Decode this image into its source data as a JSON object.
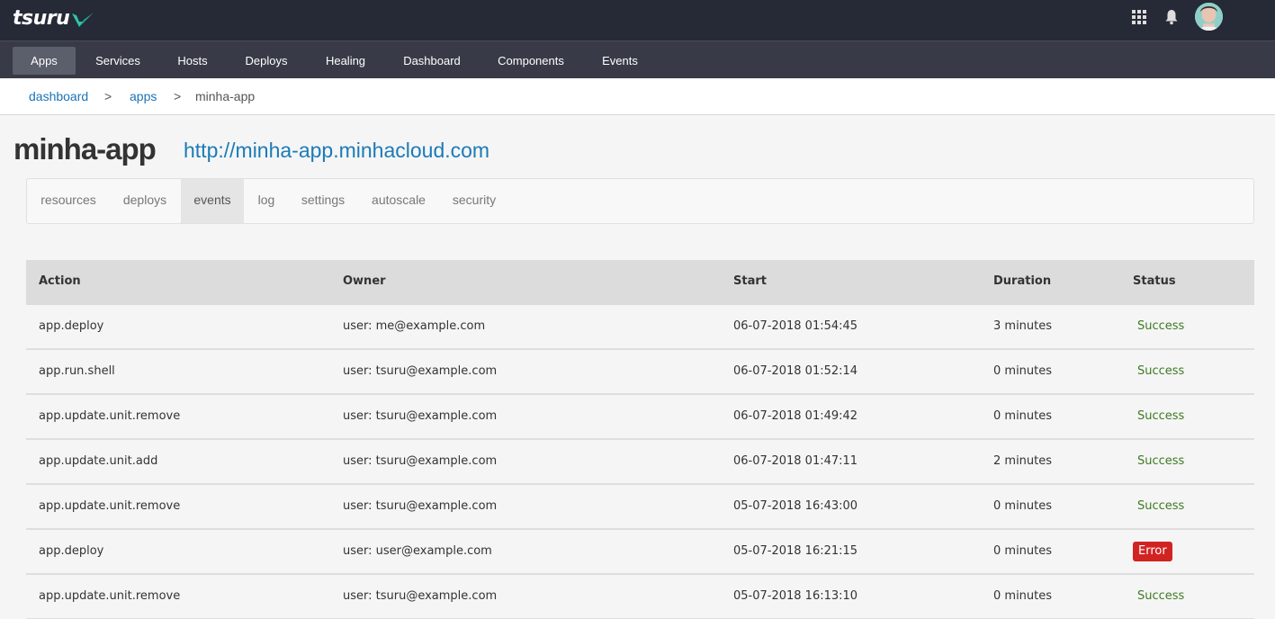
{
  "brand": {
    "name": "tsuru",
    "logo_mark_color": "#2ec4a4"
  },
  "topbar": {
    "icons": [
      "apps-grid-icon",
      "bell-icon",
      "avatar"
    ]
  },
  "nav": {
    "items": [
      {
        "label": "Apps",
        "active": true
      },
      {
        "label": "Services",
        "active": false
      },
      {
        "label": "Hosts",
        "active": false
      },
      {
        "label": "Deploys",
        "active": false
      },
      {
        "label": "Healing",
        "active": false
      },
      {
        "label": "Dashboard",
        "active": false
      },
      {
        "label": "Components",
        "active": false
      },
      {
        "label": "Events",
        "active": false
      }
    ]
  },
  "breadcrumb": {
    "items": [
      "dashboard",
      "apps",
      "minha-app"
    ],
    "separator": ">"
  },
  "app": {
    "name": "minha-app",
    "url": "http://minha-app.minhacloud.com"
  },
  "tabs": {
    "items": [
      {
        "label": "resources",
        "active": false
      },
      {
        "label": "deploys",
        "active": false
      },
      {
        "label": "events",
        "active": true
      },
      {
        "label": "log",
        "active": false
      },
      {
        "label": "settings",
        "active": false
      },
      {
        "label": "autoscale",
        "active": false
      },
      {
        "label": "security",
        "active": false
      }
    ]
  },
  "events_table": {
    "columns": [
      "Action",
      "Owner",
      "Start",
      "Duration",
      "Status"
    ],
    "rows": [
      {
        "action": "app.deploy",
        "owner": "user: me@example.com",
        "start": "06-07-2018 01:54:45",
        "duration": "3 minutes",
        "status": "Success"
      },
      {
        "action": "app.run.shell",
        "owner": "user: tsuru@example.com",
        "start": "06-07-2018 01:52:14",
        "duration": "0 minutes",
        "status": "Success"
      },
      {
        "action": "app.update.unit.remove",
        "owner": "user: tsuru@example.com",
        "start": "06-07-2018 01:49:42",
        "duration": "0 minutes",
        "status": "Success"
      },
      {
        "action": "app.update.unit.add",
        "owner": "user: tsuru@example.com",
        "start": "06-07-2018 01:47:11",
        "duration": "2 minutes",
        "status": "Success"
      },
      {
        "action": "app.update.unit.remove",
        "owner": "user: tsuru@example.com",
        "start": "05-07-2018 16:43:00",
        "duration": "0 minutes",
        "status": "Success"
      },
      {
        "action": "app.deploy",
        "owner": "user: user@example.com",
        "start": "05-07-2018 16:21:15",
        "duration": "0 minutes",
        "status": "Error"
      },
      {
        "action": "app.update.unit.remove",
        "owner": "user: tsuru@example.com",
        "start": "05-07-2018 16:13:10",
        "duration": "0 minutes",
        "status": "Success"
      }
    ]
  },
  "colors": {
    "topbar_bg": "#262936",
    "navbar_bg": "#383b47",
    "link": "#1a73b8",
    "success": "#3f7a23",
    "error": "#d22323"
  }
}
